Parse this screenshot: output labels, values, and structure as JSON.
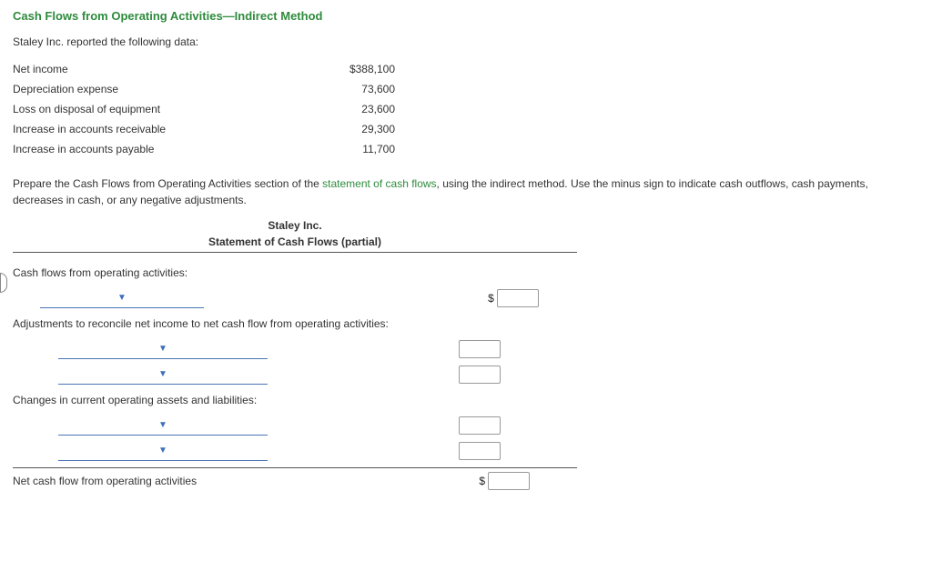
{
  "title": "Cash Flows from Operating Activities—Indirect Method",
  "intro": "Staley Inc. reported the following data:",
  "data_rows": [
    {
      "label": "Net income",
      "value": "$388,100"
    },
    {
      "label": "Depreciation expense",
      "value": "73,600"
    },
    {
      "label": "Loss on disposal of equipment",
      "value": "23,600"
    },
    {
      "label": "Increase in accounts receivable",
      "value": "29,300"
    },
    {
      "label": "Increase in accounts payable",
      "value": "11,700"
    }
  ],
  "question_part1": "Prepare the Cash Flows from Operating Activities section of the ",
  "question_link": "statement of cash flows",
  "question_part2": ", using the indirect method. Use the minus sign to indicate cash outflows, cash payments, decreases in cash, or any negative adjustments.",
  "statement": {
    "company": "Staley Inc.",
    "title": "Statement of Cash Flows (partial)"
  },
  "worksheet": {
    "section1": "Cash flows from operating activities:",
    "section2": "Adjustments to reconcile net income to net cash flow from operating activities:",
    "section3": "Changes in current operating assets and liabilities:",
    "net_line": "Net cash flow from operating activities"
  },
  "currency": "$"
}
